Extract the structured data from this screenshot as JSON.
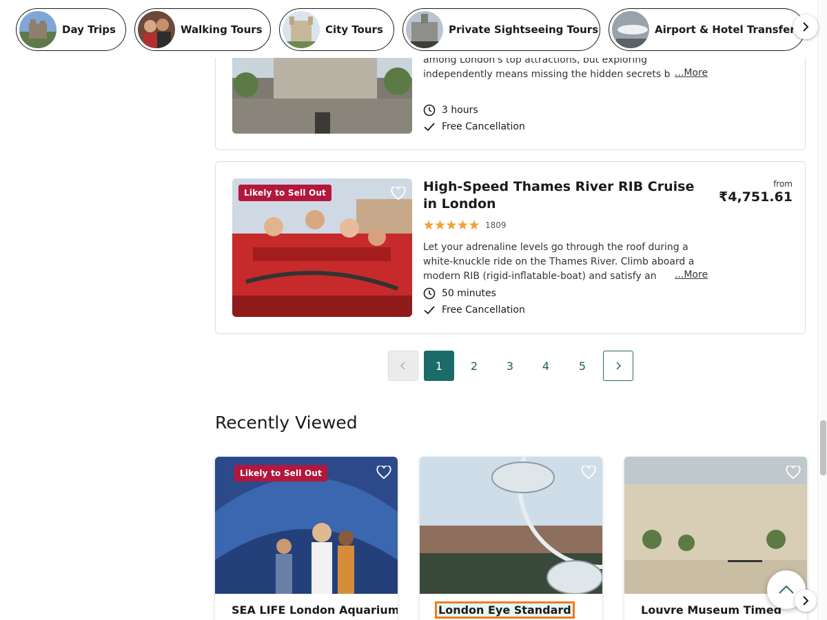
{
  "categories": [
    {
      "label": "Day Trips",
      "icon": "castle-photo"
    },
    {
      "label": "Walking Tours",
      "icon": "people-photo"
    },
    {
      "label": "City Tours",
      "icon": "tower-photo"
    },
    {
      "label": "Private Sightseeing Tours",
      "icon": "cathedral-photo"
    },
    {
      "label": "Airport & Hotel Transfers",
      "icon": "airplane-photo"
    }
  ],
  "results": [
    {
      "description": "among London's top attractions, but exploring independently means missing the hidden secrets b",
      "more_label": "...More",
      "duration": "3 hours",
      "cancellation": "Free Cancellation"
    },
    {
      "badge": "Likely to Sell Out",
      "title": "High-Speed Thames River RIB Cruise in London",
      "review_count": "1809",
      "rating": 5,
      "from_label": "from",
      "price": "₹4,751.61",
      "description": "Let your adrenaline levels go through the roof during a white-knuckle ride on the Thames River. Climb aboard a modern RIB (rigid-inflatable-boat) and satisfy an",
      "more_label": "...More",
      "duration": "50 minutes",
      "cancellation": "Free Cancellation"
    }
  ],
  "pagination": {
    "prev_icon": "chevron-left-icon",
    "pages": [
      "1",
      "2",
      "3",
      "4",
      "5"
    ],
    "current": "1",
    "next_icon": "chevron-right-icon"
  },
  "recently_viewed": {
    "title": "Recently Viewed",
    "items": [
      {
        "name": "SEA LIFE London Aquarium",
        "badge": "Likely to Sell Out"
      },
      {
        "name": "London Eye Standard"
      },
      {
        "name": "Louvre Museum Timed"
      }
    ]
  },
  "colors": {
    "accent": "#1d6b69",
    "badge": "#b3173c",
    "star": "#f2a13a",
    "focus": "#f07b18"
  }
}
